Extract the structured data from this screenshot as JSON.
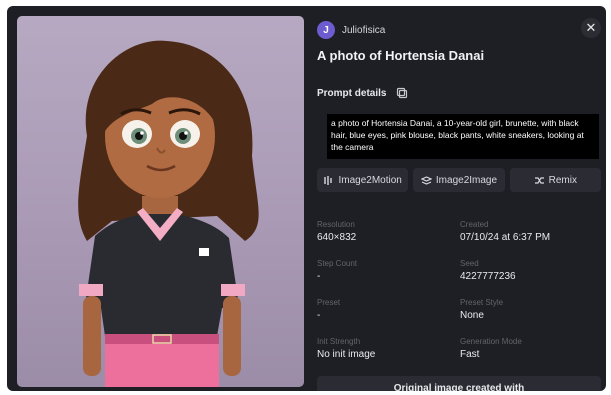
{
  "author": {
    "initial": "J",
    "name": "Juliofisica"
  },
  "title": "A photo of Hortensia Danai",
  "prompt": {
    "heading": "Prompt details",
    "text": "a photo of Hortensia Danai, a 10-year-old girl, brunette, with black hair, blue eyes, pink blouse, black pants, white sneakers, looking at the camera"
  },
  "actions": {
    "image2motion": "Image2Motion",
    "image2image": "Image2Image",
    "remix": "Remix"
  },
  "meta": {
    "resolution_label": "Resolution",
    "resolution": "640×832",
    "created_label": "Created",
    "created": "07/10/24 at 6:37 PM",
    "step_count_label": "Step Count",
    "step_count": "-",
    "seed_label": "Seed",
    "seed": "4227777236",
    "preset_label": "Preset",
    "preset": "-",
    "preset_style_label": "Preset Style",
    "preset_style": "None",
    "init_strength_label": "Init Strength",
    "init_strength": "No init image",
    "generation_mode_label": "Generation Mode",
    "generation_mode": "Fast"
  },
  "footer": {
    "original_label": "Original image created with"
  },
  "colors": {
    "modal_bg": "#1e1f24",
    "button_bg": "#2b2c33",
    "avatar": "#6d5bd0"
  }
}
